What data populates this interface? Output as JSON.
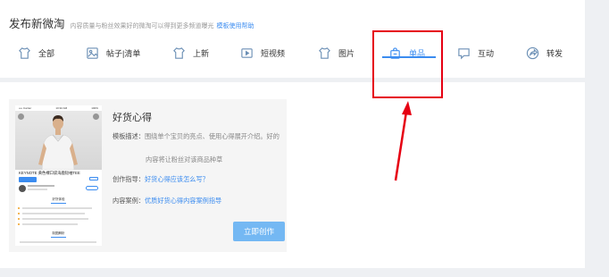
{
  "header": {
    "title": "发布新微淘",
    "description": "内容质量与粉丝效果好的微淘可以得到更多频道曝光",
    "help_link": "模板使用帮助"
  },
  "tabs": [
    {
      "label": "全部",
      "icon": "shirt-icon"
    },
    {
      "label": "帖子|清单",
      "icon": "image-list-icon"
    },
    {
      "label": "上新",
      "icon": "shirt-icon"
    },
    {
      "label": "短视频",
      "icon": "video-icon"
    },
    {
      "label": "图片",
      "icon": "shirt-icon"
    },
    {
      "label": "单品",
      "icon": "shopping-bag-icon",
      "active": true
    },
    {
      "label": "互动",
      "icon": "chat-icon"
    },
    {
      "label": "转发",
      "icon": "share-icon"
    }
  ],
  "template_card": {
    "title": "好货心得",
    "desc_label": "模板描述：",
    "desc_line1": "围绕单个宝贝的亮点、使用心得展开介绍。好的",
    "desc_line2": "内容将让粉丝对该商品种草",
    "guide_label": "创作指导：",
    "guide_link": "好货心得应该怎么写？",
    "example_label": "内容案例：",
    "example_link": "优质好货心得内容案例指导",
    "create_button": "立即创作",
    "preview": {
      "status_carrier": "•••• Carrier",
      "status_time": "10:32 AM",
      "status_battery": "100%",
      "product_title": "KEYNOTE 黄色裸口袋海鹿短袖TEE",
      "section_1": "好货体验",
      "section_2": "制图解析"
    }
  },
  "colors": {
    "accent": "#3b8cf0",
    "button_bg": "#74b8f3",
    "annotation": "#e60012",
    "page_bg": "#eef0f3"
  }
}
